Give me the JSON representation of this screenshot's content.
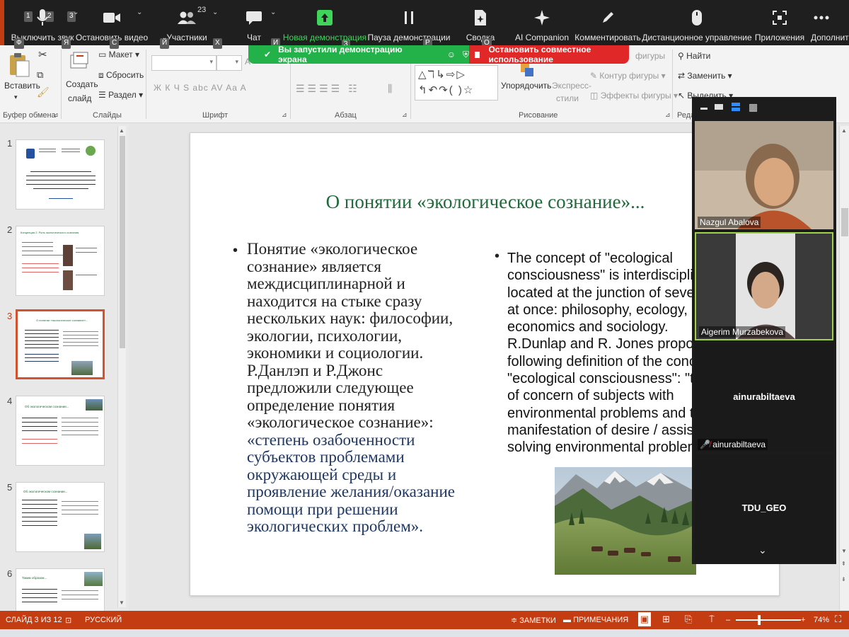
{
  "zoom_toolbar": {
    "shortcut_keys": [
      "1",
      "2",
      "3",
      "3"
    ],
    "participants_count": "23",
    "buttons": {
      "mute": "Выключить звук",
      "stop_video": "Остановить видео",
      "participants": "Участники",
      "chat": "Чат",
      "new_share": "Новая демонстрация",
      "pause_share": "Пауза демонстрации",
      "summary": "Сводка",
      "ai": "AI Companion",
      "annotate": "Комментировать",
      "remote": "Дистанционное управление",
      "apps": "Приложения",
      "more": "Дополнительно"
    },
    "share_notice": "Вы запустили демонстрацию экрана",
    "stop_share": "Остановить совместное использование"
  },
  "ribbon_keytips": [
    "Ф",
    "Я",
    "С",
    "Й",
    "Х",
    "И",
    "Р",
    "О"
  ],
  "ribbon": {
    "paste": "Вставить",
    "create_slide_1": "Создать",
    "create_slide_2": "слайд",
    "layout": "Макет",
    "reset": "Сбросить",
    "section": "Раздел",
    "font_buttons": "Ж  К  Ч  S  abc  AV  Aa  A",
    "arrange": "Упорядочить",
    "express_1": "Экспресс-",
    "express_2": "стили",
    "shape_fill": "фигуры",
    "shape_outline": "Контур фигуры",
    "shape_effects": "Эффекты фигуры",
    "find": "Найти",
    "replace": "Заменить",
    "select": "Выделить",
    "groups": {
      "clipboard": "Буфер обмена",
      "slides": "Слайды",
      "font": "Шрифт",
      "paragraph": "Абзац",
      "drawing": "Рисование",
      "editing": "Реда"
    }
  },
  "thumbnails": [
    {
      "num": "1"
    },
    {
      "num": "2"
    },
    {
      "num": "3"
    },
    {
      "num": "4"
    },
    {
      "num": "5"
    },
    {
      "num": "6"
    }
  ],
  "thumbnail_titles": {
    "t2": "Концепция 2. Роль экологического сознания",
    "t3": "О понятии «экологическое сознание»...",
    "t4": "Об экологическом сознании...",
    "t5": "Об экологическом сознании...",
    "t6": "Таким образом..."
  },
  "slide": {
    "title": "О понятии «экологическое сознание»...",
    "ru_lines": [
      "Понятие «экологическое",
      "сознание» является",
      "междисциплинарной и",
      "находится на стыке сразу",
      "нескольких наук: философии,",
      "экологии, психологии,",
      "экономики и социологии.",
      "Р.Данлэп и Р.Джонс",
      "предложили следующее",
      "определение понятия",
      "«экологическое сознание»:"
    ],
    "ru_quote": [
      "«степень озабоченности",
      "субъектов проблемами",
      "окружающей среды и",
      "проявление желания/оказание",
      "помощи при решении",
      "экологических проблем»."
    ],
    "en_lines": [
      "The concept of \"ecological",
      "consciousness\" is interdisciplina",
      "located at the junction of sever",
      "at once: philosophy, ecology, ps",
      "economics and sociology.",
      "R.Dunlap and R. Jones propose",
      "following definition of the conc",
      "\"ecological consciousness\": \"th",
      "of concern of subjects with",
      "environmental problems and th",
      "manifestation of desire / assista",
      "solving environmental problem"
    ]
  },
  "gallery": {
    "participant_1": "Nazgul Abalova",
    "participant_2": "Aigerim Murzabekova",
    "participant_3_center": "ainurabiltaeva",
    "participant_3_label": "ainurabiltaeva",
    "participant_4": "TDU_GEO"
  },
  "status_bar": {
    "slide_counter": "СЛАЙД 3 ИЗ 12",
    "language": "РУССКИЙ",
    "notes": "ЗАМЕТКИ",
    "comments": "ПРИМЕЧАНИЯ",
    "zoom": "74%"
  },
  "colors": {
    "zoom_bg": "#1f1f1f",
    "share_green": "#23b24a",
    "stop_red": "#e02828",
    "ppt_orange": "#c43c12",
    "title_green": "#1e6b3a",
    "quote_blue": "#1f3864"
  }
}
